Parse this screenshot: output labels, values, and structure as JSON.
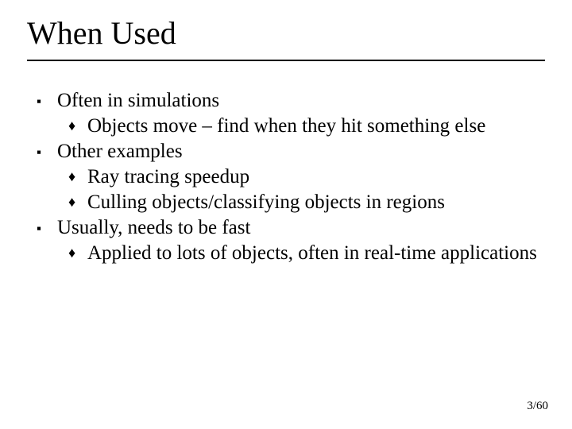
{
  "title": "When Used",
  "bullets": {
    "a": "Often in simulations",
    "a1": "Objects move – find when they hit something else",
    "b": "Other examples",
    "b1": "Ray tracing speedup",
    "b2": "Culling objects/classifying objects in regions",
    "c": "Usually, needs to be fast",
    "c1": "Applied to lots of objects, often in real-time applications"
  },
  "glyphs": {
    "square": "▪",
    "diamond": "♦"
  },
  "page": "3/60"
}
